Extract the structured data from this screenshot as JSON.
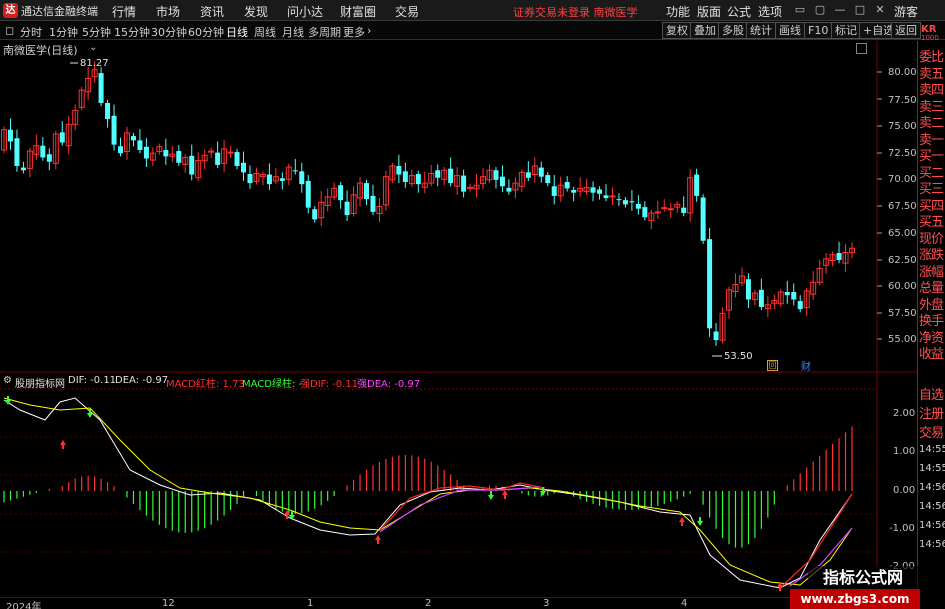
{
  "app": {
    "name": "通达信金融终端",
    "logo_letter": "达",
    "menus": [
      "行情",
      "市场",
      "资讯",
      "发现",
      "问小达",
      "财富圈",
      "交易"
    ],
    "status": "证券交易未登录  南微医学",
    "right_menus": [
      "功能",
      "版面",
      "公式",
      "选项"
    ],
    "guest": "游客",
    "window_buttons": [
      "▭",
      "▢",
      "—",
      "□",
      "✕"
    ]
  },
  "toolbar": {
    "periods": [
      "分时",
      "1分钟",
      "5分钟",
      "15分钟",
      "30分钟",
      "60分钟",
      "日线",
      "周线",
      "月线",
      "多周期",
      "更多"
    ],
    "active_period": "日线",
    "right_tools": [
      "复权",
      "叠加",
      "多股",
      "统计",
      "画线",
      "F10",
      "标记",
      "+自选",
      "返回"
    ]
  },
  "chart_title": "南微医学(日线)",
  "price_axis": [
    "80.00",
    "77.50",
    "75.00",
    "72.50",
    "70.00",
    "67.50",
    "65.00",
    "62.50",
    "60.00",
    "57.50",
    "55.00"
  ],
  "high_label": "81.27",
  "low_label": "53.50",
  "markers": [
    "回",
    "财"
  ],
  "indicator": {
    "name": "股朋指标网",
    "items": [
      {
        "label": "DIF: -0.11",
        "color": "#e0e0e0"
      },
      {
        "label": "DEA: -0.97",
        "color": "#e0e0e0"
      },
      {
        "label": "MACD红柱: 1.73",
        "color": "#ff3030"
      },
      {
        "label": "MACD绿柱: -",
        "color": "#30ff30"
      },
      {
        "label": "强DIF: -0.11",
        "color": "#ff3030"
      },
      {
        "label": "强DEA: -0.97",
        "color": "#ff40ff"
      }
    ],
    "axis": [
      "2.00",
      "1.00",
      "0.00",
      "-1.00",
      "-2.00"
    ]
  },
  "right_panel": [
    "委比",
    "卖五",
    "卖四",
    "卖三",
    "卖二",
    "卖一",
    "买一",
    "买二",
    "买三",
    "买四",
    "买五",
    "现价",
    "涨跌",
    "涨幅",
    "总量",
    "外盘",
    "换手",
    "净资",
    "收益",
    "自选",
    "注册",
    "交易"
  ],
  "right_code": "KR",
  "right_code2": "1000",
  "right_times": [
    "14:55",
    "14:55",
    "14:56",
    "14:56",
    "14:56",
    "14:56"
  ],
  "x_labels": [
    "2024年",
    "12",
    "1",
    "2",
    "3",
    "4"
  ],
  "watermark": {
    "top": "指标公式网",
    "bottom": "www.zbgs3.com"
  },
  "colors": {
    "up": "#ff3232",
    "down": "#54ffff",
    "dif": "#ffffff",
    "dea": "#ffff00",
    "qdif": "#ff2020",
    "qdea": "#d040ff",
    "grid": "#7a0000"
  }
}
